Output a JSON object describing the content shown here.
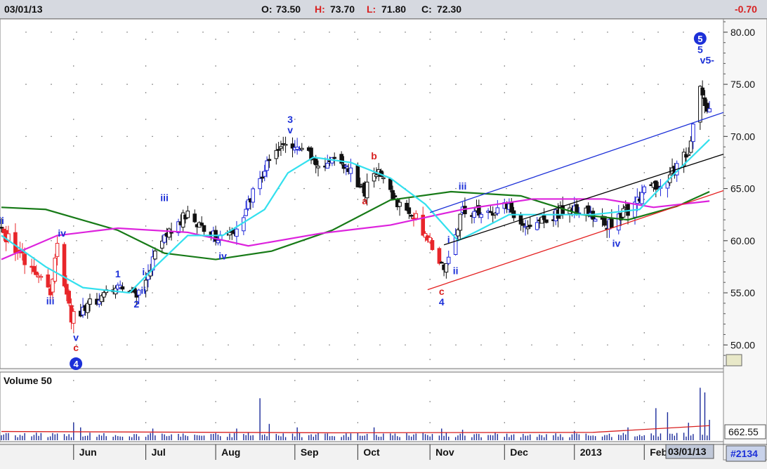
{
  "header": {
    "date": "03/01/13",
    "open_label": "O:",
    "open": "73.50",
    "high_label": "H:",
    "high": "73.70",
    "low_label": "L:",
    "low": "71.80",
    "close_label": "C:",
    "close": "72.30",
    "change": "-0.70"
  },
  "colors": {
    "up_bar": "#1e26d8",
    "down_bar": "#e8262a",
    "neutral_bar": "#111111",
    "ma_short": "#33e0ee",
    "ma_mid": "#dd22dd",
    "ma_long": "#177a17",
    "channel_blue": "#1c30d8",
    "channel_black": "#000000",
    "channel_red": "#e42020",
    "volume_bar": "#1a2a9a",
    "volume_avg": "#d82020",
    "wave_blue": "#1c30d8",
    "wave_red": "#d82020"
  },
  "volume_panel": {
    "label": "Volume 50",
    "value": "662.55"
  },
  "footer": {
    "date_badge": "03/01/13",
    "chart_number": "#2134"
  },
  "chart_data": [
    {
      "type": "candlestick",
      "y_ticks": [
        "80.00",
        "75.00",
        "70.00",
        "65.00",
        "60.00",
        "55.00",
        "50.00"
      ],
      "ylim": [
        48,
        81
      ],
      "x_ticks": [
        "Jun",
        "Jul",
        "Aug",
        "Sep",
        "Oct",
        "Nov",
        "Dec",
        "2013",
        "Feb"
      ],
      "x_tick_dates": [
        "2012-06-01",
        "2012-07-02",
        "2012-08-01",
        "2012-09-04",
        "2012-10-01",
        "2012-11-01",
        "2012-12-03",
        "2013-01-02",
        "2013-02-01"
      ],
      "xlim": [
        "2012-05-01",
        "2013-03-07"
      ],
      "price_path": [
        [
          "2012-05-01",
          61.0
        ],
        [
          "2012-05-14",
          57.0
        ],
        [
          "2012-05-22",
          55.0
        ],
        [
          "2012-05-25",
          59.8
        ],
        [
          "2012-05-31",
          52.5
        ],
        [
          "2012-06-12",
          54.5
        ],
        [
          "2012-06-20",
          55.8
        ],
        [
          "2012-06-28",
          55.0
        ],
        [
          "2012-07-12",
          61.0
        ],
        [
          "2012-07-20",
          62.5
        ],
        [
          "2012-08-01",
          60.5
        ],
        [
          "2012-08-10",
          61.0
        ],
        [
          "2012-08-22",
          67.0
        ],
        [
          "2012-08-29",
          69.0
        ],
        [
          "2012-09-07",
          68.5
        ],
        [
          "2012-09-14",
          67.5
        ],
        [
          "2012-09-25",
          67.5
        ],
        [
          "2012-10-04",
          64.5
        ],
        [
          "2012-10-08",
          67.0
        ],
        [
          "2012-10-17",
          64.0
        ],
        [
          "2012-10-23",
          63.0
        ],
        [
          "2012-10-29",
          61.0
        ],
        [
          "2012-11-07",
          57.5
        ],
        [
          "2012-11-15",
          63.0
        ],
        [
          "2012-11-26",
          62.5
        ],
        [
          "2012-12-04",
          63.5
        ],
        [
          "2012-12-10",
          61.5
        ],
        [
          "2012-12-17",
          61.5
        ],
        [
          "2012-12-28",
          63.0
        ],
        [
          "2013-01-09",
          62.5
        ],
        [
          "2013-01-16",
          61.5
        ],
        [
          "2013-01-23",
          62.5
        ],
        [
          "2013-01-31",
          64.5
        ],
        [
          "2013-02-08",
          65.5
        ],
        [
          "2013-02-15",
          67.0
        ],
        [
          "2013-02-20",
          68.5
        ],
        [
          "2013-02-25",
          74.5
        ],
        [
          "2013-03-01",
          72.3
        ]
      ],
      "ma_short": [
        [
          "2012-05-01",
          60.5
        ],
        [
          "2012-05-20",
          57.5
        ],
        [
          "2012-06-05",
          55.5
        ],
        [
          "2012-06-25",
          55.0
        ],
        [
          "2012-07-06",
          57.5
        ],
        [
          "2012-07-20",
          60.5
        ],
        [
          "2012-08-04",
          60.5
        ],
        [
          "2012-08-22",
          63.0
        ],
        [
          "2012-09-01",
          66.5
        ],
        [
          "2012-09-12",
          68.0
        ],
        [
          "2012-09-28",
          67.5
        ],
        [
          "2012-10-15",
          66.0
        ],
        [
          "2012-10-30",
          63.5
        ],
        [
          "2012-11-13",
          60.0
        ],
        [
          "2012-11-22",
          61.0
        ],
        [
          "2012-12-05",
          62.5
        ],
        [
          "2012-12-22",
          62.5
        ],
        [
          "2013-01-10",
          62.5
        ],
        [
          "2013-01-30",
          63.0
        ],
        [
          "2013-02-12",
          66.0
        ],
        [
          "2013-03-01",
          69.7
        ]
      ],
      "ma_mid": [
        [
          "2012-05-01",
          58.2
        ],
        [
          "2012-05-25",
          60.5
        ],
        [
          "2012-06-20",
          61.2
        ],
        [
          "2012-07-20",
          60.8
        ],
        [
          "2012-08-15",
          59.5
        ],
        [
          "2012-09-15",
          60.7
        ],
        [
          "2012-10-15",
          61.5
        ],
        [
          "2012-11-15",
          63.0
        ],
        [
          "2012-12-15",
          64.0
        ],
        [
          "2013-01-15",
          64.0
        ],
        [
          "2013-02-05",
          63.2
        ],
        [
          "2013-03-01",
          63.8
        ]
      ],
      "ma_long": [
        [
          "2012-05-01",
          63.2
        ],
        [
          "2012-05-20",
          63.0
        ],
        [
          "2012-06-20",
          61.0
        ],
        [
          "2012-07-10",
          58.8
        ],
        [
          "2012-08-01",
          58.2
        ],
        [
          "2012-08-25",
          59.0
        ],
        [
          "2012-09-20",
          61.0
        ],
        [
          "2012-10-15",
          63.9
        ],
        [
          "2012-11-10",
          64.7
        ],
        [
          "2012-12-10",
          64.3
        ],
        [
          "2013-01-05",
          62.5
        ],
        [
          "2013-01-25",
          62.0
        ],
        [
          "2013-02-15",
          63.3
        ],
        [
          "2013-03-01",
          64.7
        ]
      ],
      "channels": [
        {
          "color": "channel_blue",
          "from": [
            "2012-11-01",
            62.7
          ],
          "to": [
            "2013-03-07",
            72.3
          ]
        },
        {
          "color": "channel_black",
          "from": [
            "2012-11-07",
            59.6
          ],
          "to": [
            "2013-03-07",
            68.3
          ]
        },
        {
          "color": "channel_red",
          "from": [
            "2012-10-31",
            55.3
          ],
          "to": [
            "2013-03-07",
            64.8
          ]
        }
      ],
      "wave_labels": [
        {
          "text": "ii",
          "color": "wave_blue",
          "at": [
            "2012-05-01",
            61.6
          ]
        },
        {
          "text": "iv",
          "color": "wave_blue",
          "at": [
            "2012-05-27",
            60.4
          ]
        },
        {
          "text": "iii",
          "color": "wave_blue",
          "at": [
            "2012-05-22",
            53.9
          ]
        },
        {
          "text": "v",
          "color": "wave_blue",
          "at": [
            "2012-06-02",
            50.4
          ]
        },
        {
          "text": "c",
          "color": "wave_red",
          "at": [
            "2012-06-02",
            49.4
          ]
        },
        {
          "text": "1",
          "color": "wave_blue",
          "at": [
            "2012-06-20",
            56.5
          ]
        },
        {
          "text": "2",
          "color": "wave_blue",
          "at": [
            "2012-06-28",
            53.6
          ]
        },
        {
          "text": "i",
          "color": "wave_blue",
          "at": [
            "2012-07-01",
            56.7
          ]
        },
        {
          "text": "ii",
          "color": "wave_blue",
          "at": [
            "2012-07-01",
            54.9
          ]
        },
        {
          "text": "iii",
          "color": "wave_blue",
          "at": [
            "2012-07-10",
            63.8
          ]
        },
        {
          "text": "iv",
          "color": "wave_blue",
          "at": [
            "2012-08-04",
            58.2
          ]
        },
        {
          "text": "3",
          "color": "wave_blue",
          "at": [
            "2012-09-02",
            71.3
          ]
        },
        {
          "text": "v",
          "color": "wave_blue",
          "at": [
            "2012-09-02",
            70.3
          ]
        },
        {
          "text": "b",
          "color": "wave_red",
          "at": [
            "2012-10-08",
            67.8
          ]
        },
        {
          "text": "a",
          "color": "wave_red",
          "at": [
            "2012-10-04",
            63.5
          ]
        },
        {
          "text": "c",
          "color": "wave_red",
          "at": [
            "2012-11-06",
            54.8
          ]
        },
        {
          "text": "4",
          "color": "wave_blue",
          "at": [
            "2012-11-06",
            53.8
          ]
        },
        {
          "text": "i",
          "color": "wave_blue",
          "at": [
            "2012-11-09",
            59.8
          ]
        },
        {
          "text": "ii",
          "color": "wave_blue",
          "at": [
            "2012-11-12",
            56.8
          ]
        },
        {
          "text": "iii",
          "color": "wave_blue",
          "at": [
            "2012-11-15",
            64.9
          ]
        },
        {
          "text": "iv",
          "color": "wave_blue",
          "at": [
            "2013-01-20",
            59.4
          ]
        },
        {
          "text": "5",
          "color": "wave_blue",
          "at": [
            "2013-02-25",
            78.0
          ]
        },
        {
          "text": "v5-",
          "color": "wave_blue",
          "at": [
            "2013-02-28",
            77.0
          ]
        }
      ],
      "circled_labels": [
        {
          "text": "4",
          "at": [
            "2012-06-02",
            48.2
          ]
        },
        {
          "text": "5",
          "at": [
            "2013-02-25",
            79.4
          ]
        }
      ]
    },
    {
      "type": "bar",
      "title": "Volume 50",
      "last_value": "662.55",
      "spikes": [
        [
          "2012-05-20",
          0.15
        ],
        [
          "2012-05-26",
          0.25
        ],
        [
          "2012-06-01",
          0.3
        ],
        [
          "2012-06-04",
          0.22
        ],
        [
          "2012-07-05",
          0.2
        ],
        [
          "2012-08-10",
          0.2
        ],
        [
          "2012-08-20",
          0.72
        ],
        [
          "2012-08-24",
          0.28
        ],
        [
          "2012-09-05",
          0.22
        ],
        [
          "2012-10-08",
          0.22
        ],
        [
          "2012-11-06",
          0.2
        ],
        [
          "2012-11-15",
          0.18
        ],
        [
          "2012-12-02",
          0.2
        ],
        [
          "2013-01-02",
          0.16
        ],
        [
          "2013-01-25",
          0.22
        ],
        [
          "2013-02-06",
          0.55
        ],
        [
          "2013-02-11",
          0.48
        ],
        [
          "2013-02-20",
          0.3
        ],
        [
          "2013-02-25",
          0.9
        ],
        [
          "2013-02-27",
          0.82
        ],
        [
          "2013-03-01",
          0.35
        ]
      ],
      "avg_start": 0.15,
      "avg_end": 0.25
    }
  ]
}
